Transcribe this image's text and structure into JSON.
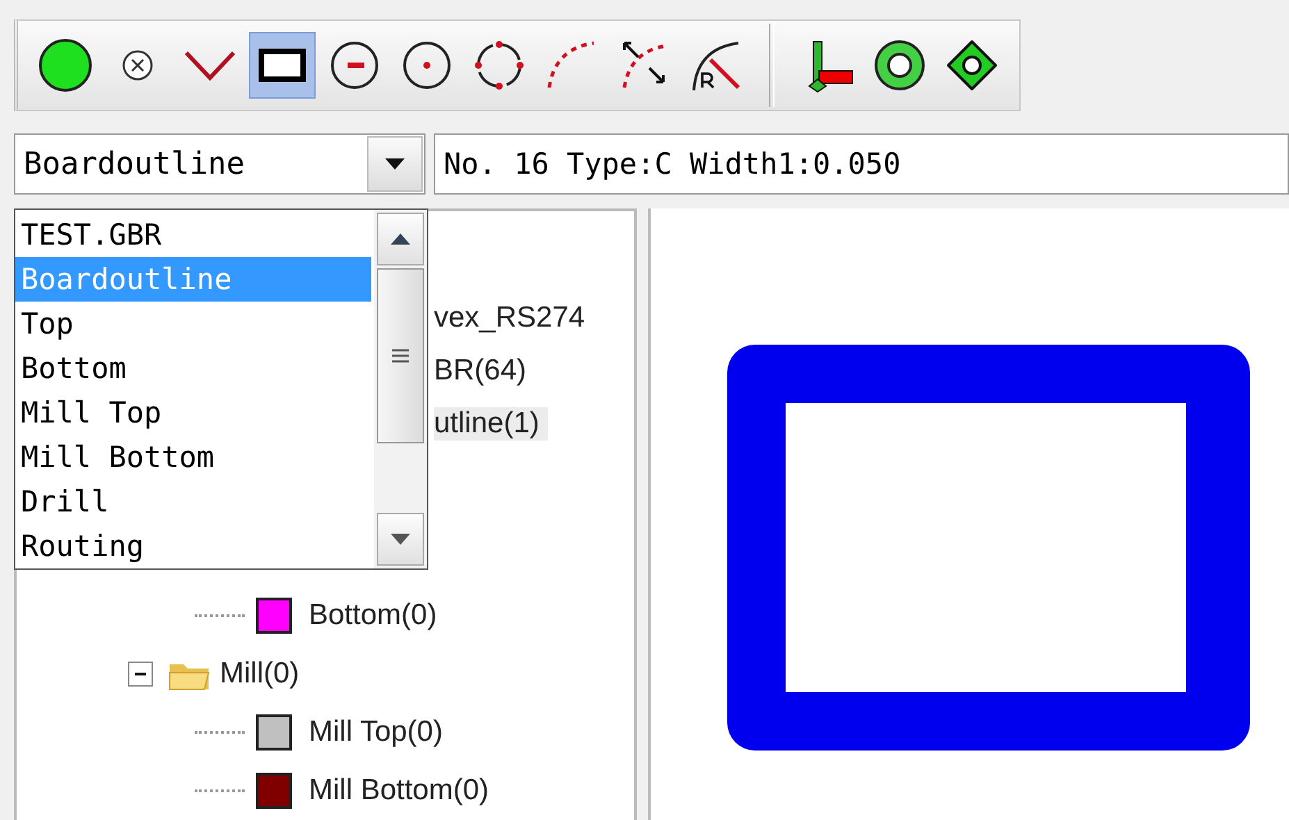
{
  "toolbar": [
    {
      "kind": "dot",
      "selected": false
    },
    {
      "kind": "cross",
      "selected": false
    },
    {
      "kind": "vee",
      "selected": false
    },
    {
      "kind": "rect",
      "selected": true
    },
    {
      "kind": "minus",
      "selected": false
    },
    {
      "kind": "center",
      "selected": false
    },
    {
      "kind": "dashcircle",
      "selected": false
    },
    {
      "kind": "arc",
      "selected": false
    },
    {
      "kind": "arcarrows",
      "selected": false
    },
    {
      "kind": "radius",
      "selected": false
    },
    {
      "kind": "separator"
    },
    {
      "kind": "origin",
      "selected": false
    },
    {
      "kind": "ring",
      "selected": false
    },
    {
      "kind": "diamond",
      "selected": false
    }
  ],
  "layer_combo": {
    "value": "Boardoutline",
    "expanded": true
  },
  "info_field": {
    "value": "No. 16 Type:C Width1:0.050"
  },
  "dropdown": [
    {
      "label": "TEST.GBR",
      "selected": false
    },
    {
      "label": "Boardoutline",
      "selected": true
    },
    {
      "label": "Top",
      "selected": false
    },
    {
      "label": "Bottom",
      "selected": false
    },
    {
      "label": "Mill Top",
      "selected": false
    },
    {
      "label": "Mill Bottom",
      "selected": false
    },
    {
      "label": "Drill",
      "selected": false
    },
    {
      "label": "Routing",
      "selected": false
    }
  ],
  "tree_fragments": [
    {
      "label": "vex_RS274",
      "selected": false
    },
    {
      "label": "BR(64)",
      "selected": false
    },
    {
      "label": "utline(1)",
      "selected": true
    }
  ],
  "layer_items": [
    {
      "label": "Bottom(0)",
      "color": "#ff00ff"
    }
  ],
  "tree": [
    {
      "label": "Mill(0)",
      "expanded": true,
      "children": [
        {
          "label": "Mill Top(0)",
          "color": "#c0c0c0"
        },
        {
          "label": "Mill Bottom(0)",
          "color": "#800000"
        }
      ]
    }
  ]
}
